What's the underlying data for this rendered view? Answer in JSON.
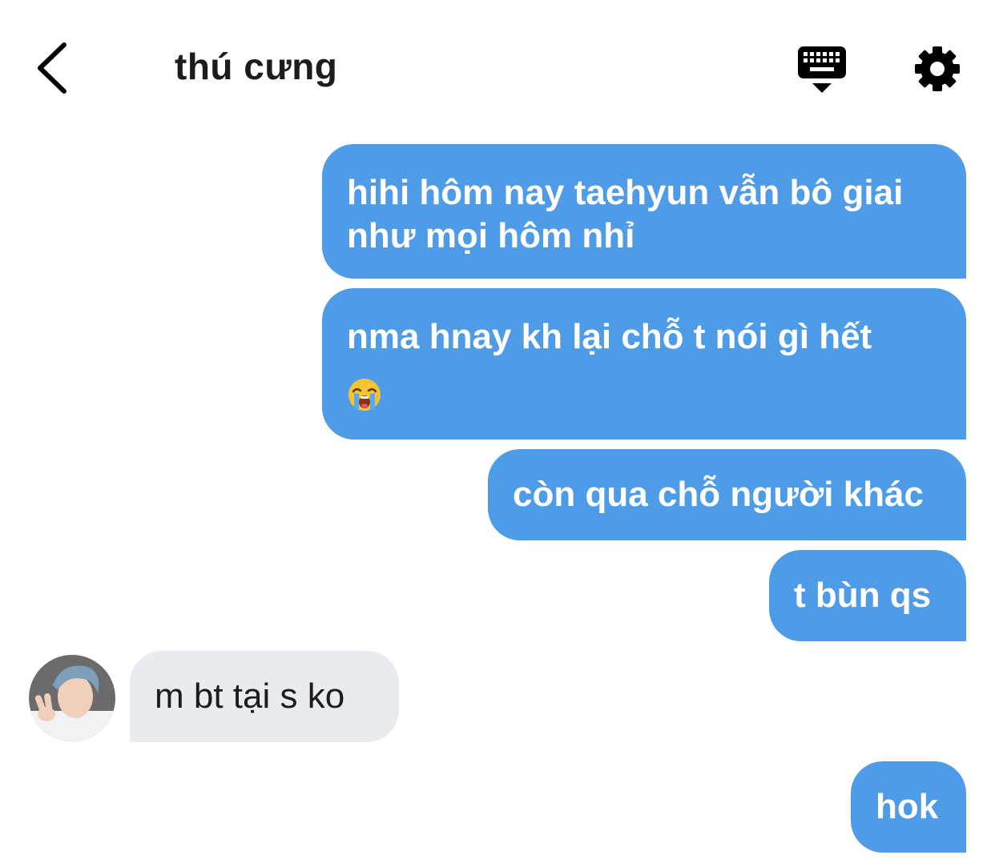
{
  "header": {
    "title": "thú cưng"
  },
  "messages": [
    {
      "sender": "me",
      "text": "hihi hôm nay taehyun vẫn bô giai như mọi hôm nhỉ"
    },
    {
      "sender": "me",
      "text": "nma hnay kh lại chỗ t nói gì hết",
      "emoji": "loudly-crying-face"
    },
    {
      "sender": "me",
      "text": "còn qua chỗ người khác"
    },
    {
      "sender": "me",
      "text": "t bùn qs"
    },
    {
      "sender": "them",
      "text": "m bt tại s ko"
    },
    {
      "sender": "me",
      "text": "hok"
    }
  ],
  "colors": {
    "sent_bubble": "#4e9be8",
    "received_bubble": "#e8ebef",
    "text_dark": "#1c1c1e"
  }
}
